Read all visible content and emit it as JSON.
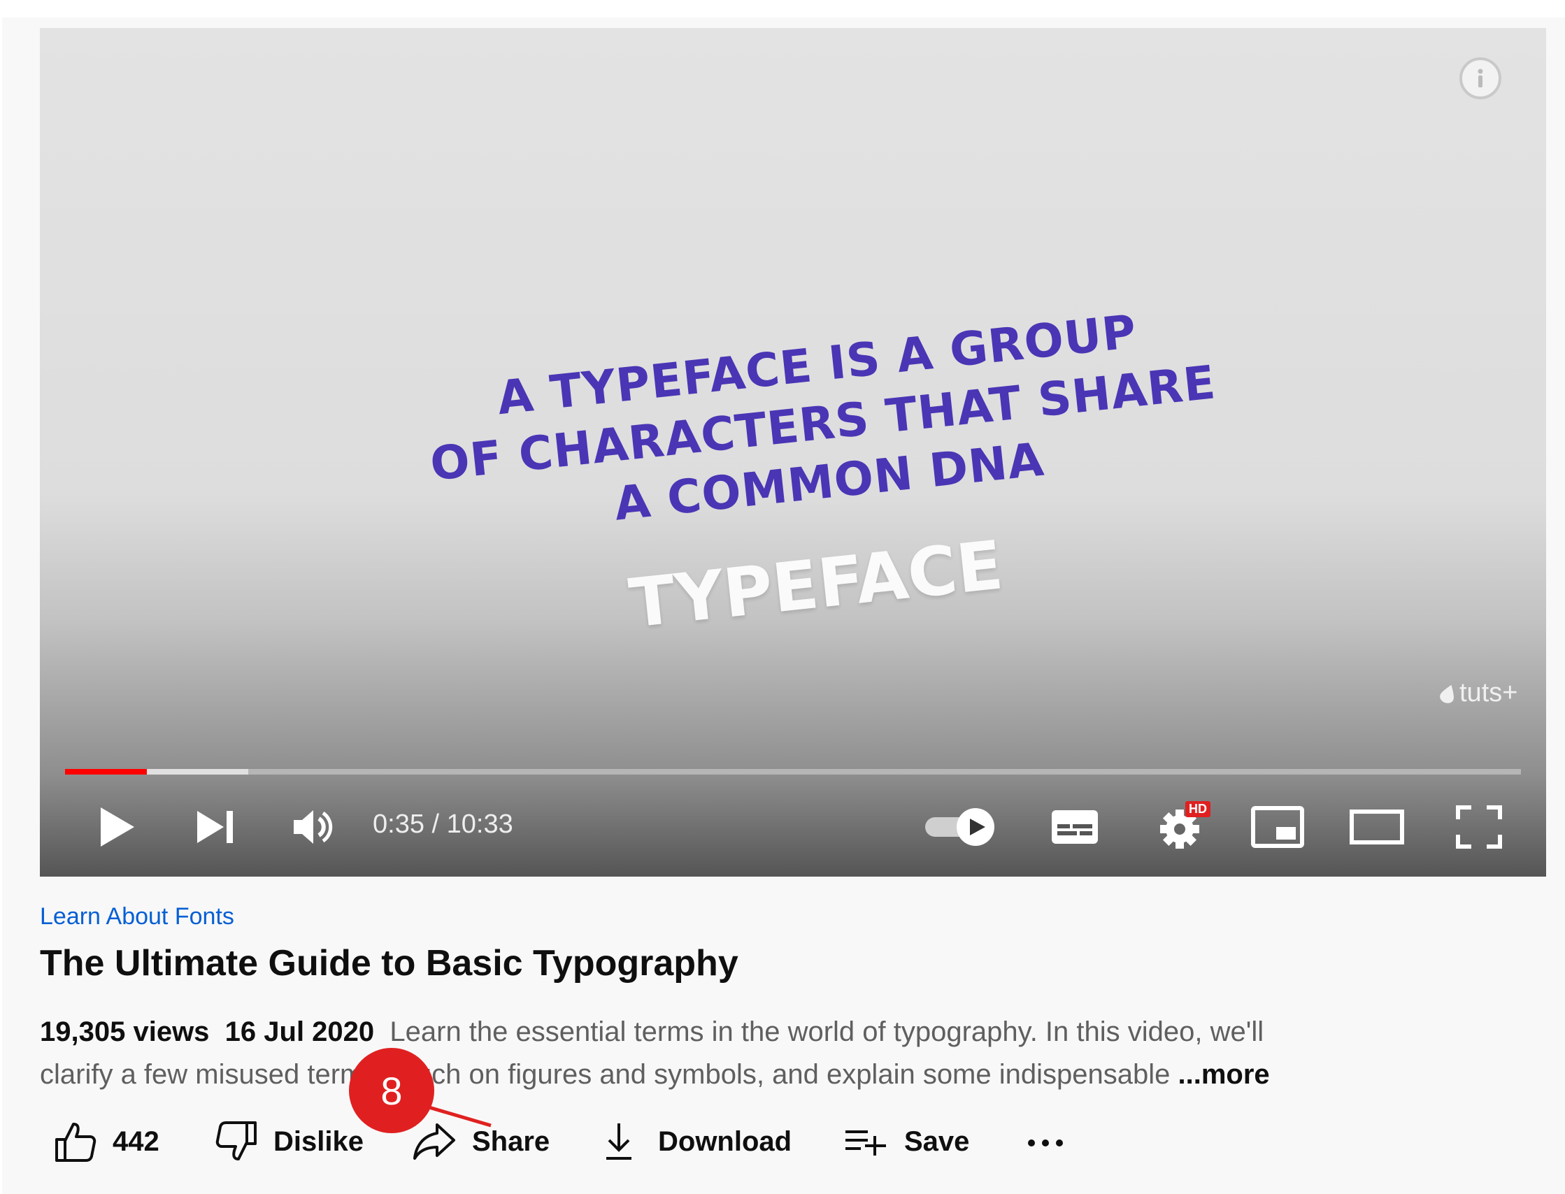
{
  "player": {
    "headline_lines": [
      "A typeface is a group",
      "of characters that share",
      "a common DNA"
    ],
    "subword": "TYPEFACE",
    "watermark": "tuts+",
    "time": "0:35 / 10:33",
    "progress": {
      "played_fraction": 0.056,
      "buffered_fraction": 0.126
    },
    "hd_badge": "HD",
    "icons": [
      "play-icon",
      "next-icon",
      "volume-icon",
      "autoplay-toggle-icon",
      "subtitles-icon",
      "settings-icon",
      "miniplayer-icon",
      "theater-mode-icon",
      "fullscreen-icon",
      "info-icon"
    ]
  },
  "video": {
    "channel": "Learn About Fonts",
    "title": "The Ultimate Guide to Basic Typography",
    "views": "19,305 views",
    "date": "16 Jul 2020",
    "description_line1": "Learn the essential terms in the world of typography. In this video, we'll",
    "description_line2": "clarify a few misused terms, touch on figures and symbols, and explain some indispensable",
    "more": "...more"
  },
  "actions": {
    "like_count": "442",
    "dislike": "Dislike",
    "share": "Share",
    "download": "Download",
    "save": "Save"
  },
  "annotation": {
    "badge_number": "8",
    "color": "#e02020"
  },
  "colors": {
    "progress_played": "#ff0000",
    "channel_link": "#065fd4",
    "headline": "#4a35b5"
  }
}
